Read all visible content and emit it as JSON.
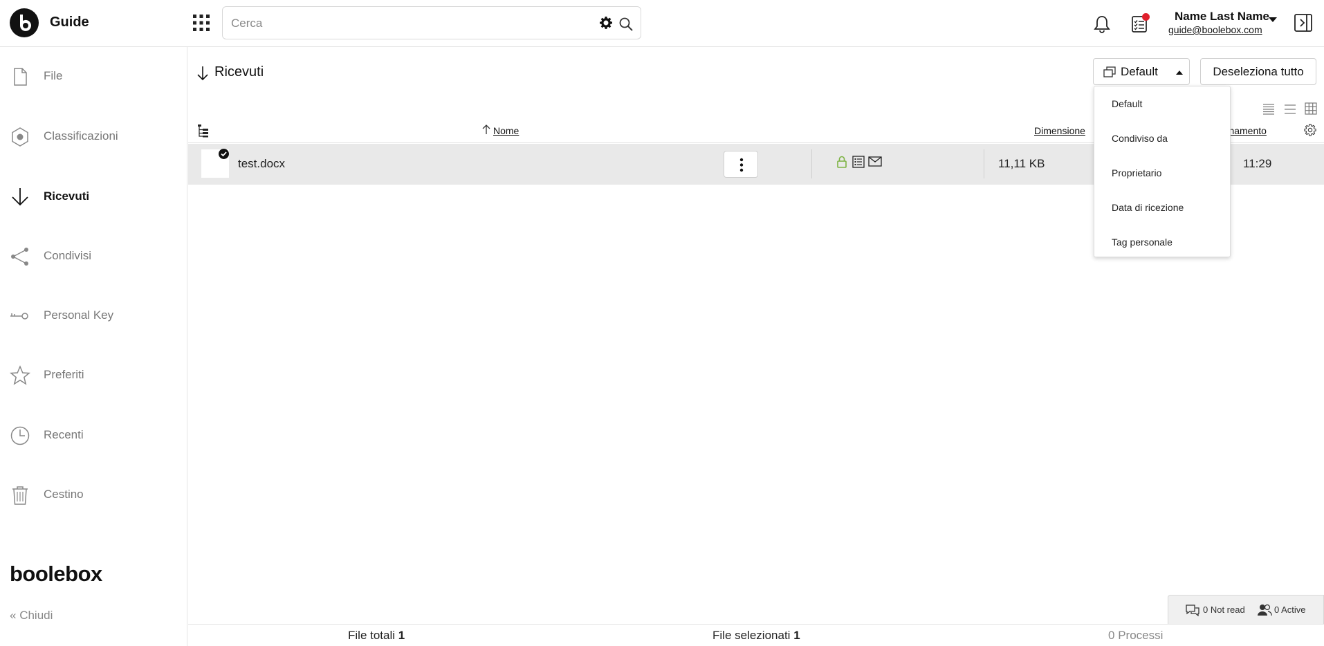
{
  "app": {
    "title": "Guide",
    "logo_letter": "b"
  },
  "search": {
    "placeholder": "Cerca"
  },
  "user": {
    "name": "Name Last Name",
    "email": "guide@boolebox.com"
  },
  "sidebar": {
    "items": [
      {
        "label": "File",
        "icon": "file-icon"
      },
      {
        "label": "Classificazioni",
        "icon": "classification-icon"
      },
      {
        "label": "Ricevuti",
        "icon": "arrow-down-icon"
      },
      {
        "label": "Condivisi",
        "icon": "share-icon"
      },
      {
        "label": "Personal Key",
        "icon": "key-icon"
      },
      {
        "label": "Preferiti",
        "icon": "star-icon"
      },
      {
        "label": "Recenti",
        "icon": "clock-icon"
      },
      {
        "label": "Cestino",
        "icon": "trash-icon"
      }
    ],
    "active_index": 2,
    "brand": "boolebox",
    "close_label": "Chiudi"
  },
  "main": {
    "title": "Ricevuti",
    "view_button": "Default",
    "deselect_button": "Deseleziona tutto",
    "dropdown": [
      "Default",
      "Condiviso da",
      "Proprietario",
      "Data di ricezione",
      "Tag personale"
    ],
    "columns": {
      "name": "Nome",
      "size": "Dimensione",
      "updated": "ornamento"
    },
    "files": [
      {
        "name": "test.docx",
        "size": "11,11 KB",
        "time": "11:29"
      }
    ]
  },
  "footer": {
    "total_label": "File totali",
    "total_value": "1",
    "selected_label": "File selezionati",
    "selected_value": "1",
    "process_count": "0",
    "process_label": "Processi"
  },
  "chat": {
    "not_read": "0 Not read",
    "active": "0 Active"
  },
  "colors": {
    "accent": "#111111",
    "notification": "#e0202c",
    "lock": "#7cb342"
  }
}
